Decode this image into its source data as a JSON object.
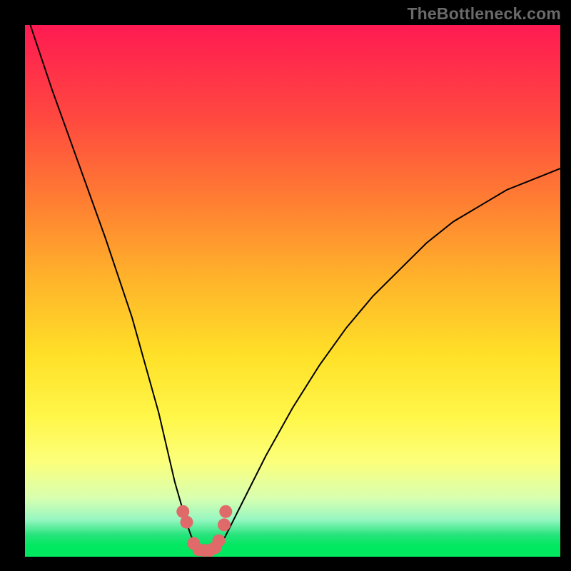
{
  "attribution": "TheBottleneck.com",
  "chart_data": {
    "type": "line",
    "title": "",
    "xlabel": "",
    "ylabel": "",
    "xlim": [
      0,
      100
    ],
    "ylim": [
      0,
      100
    ],
    "series": [
      {
        "name": "bottleneck-curve",
        "x": [
          1,
          5,
          10,
          15,
          20,
          25,
          28,
          30,
          31,
          32,
          33,
          34,
          35,
          36,
          37,
          38,
          40,
          45,
          50,
          55,
          60,
          65,
          70,
          75,
          80,
          85,
          90,
          95,
          100
        ],
        "values": [
          100,
          88,
          74,
          60,
          45,
          27,
          14,
          7,
          4,
          2,
          1,
          1,
          1,
          2,
          3,
          5,
          9,
          19,
          28,
          36,
          43,
          49,
          54,
          59,
          63,
          66,
          69,
          71,
          73
        ]
      }
    ],
    "markers": {
      "name": "highlight-points",
      "x": [
        29.5,
        30.2,
        31.5,
        32.5,
        33.5,
        34.5,
        35.5,
        36.2,
        37.2,
        37.5
      ],
      "values": [
        8.5,
        6.5,
        2.5,
        1.3,
        1.2,
        1.2,
        1.7,
        3.0,
        6.0,
        8.5
      ]
    },
    "colors": {
      "curve": "#000000",
      "marker": "#e06969",
      "gradient_top": "#ff1a52",
      "gradient_bottom": "#00e85f"
    }
  }
}
